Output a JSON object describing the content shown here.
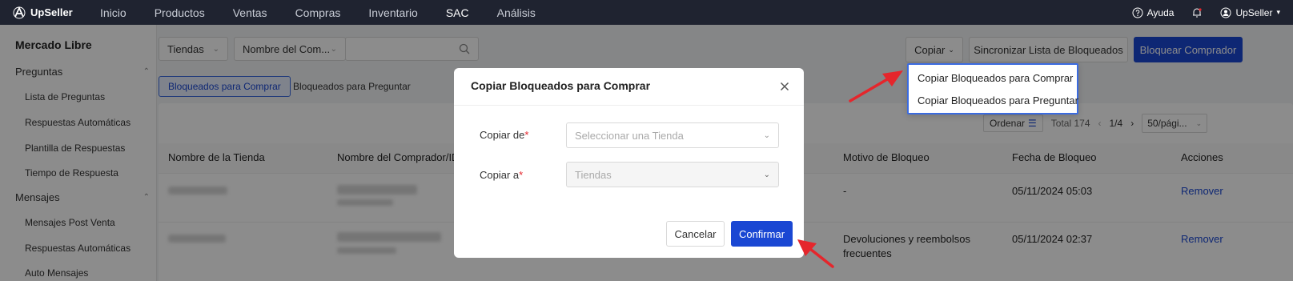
{
  "nav": {
    "brand": "UpSeller",
    "items": [
      "Inicio",
      "Productos",
      "Ventas",
      "Compras",
      "Inventario",
      "SAC",
      "Análisis"
    ],
    "active": "SAC",
    "help": "Ayuda",
    "user": "UpSeller"
  },
  "sidebar": {
    "title": "Mercado Libre",
    "sections": [
      {
        "label": "Preguntas",
        "items": [
          "Lista de Preguntas",
          "Respuestas Automáticas",
          "Plantilla de Respuestas",
          "Tiempo de Respuesta"
        ]
      },
      {
        "label": "Mensajes",
        "items": [
          "Mensajes Post Venta",
          "Respuestas Automáticas",
          "Auto Mensajes"
        ]
      }
    ]
  },
  "filters": {
    "store": "Tiendas",
    "buyer_field": "Nombre del Com...",
    "search_placeholder": ""
  },
  "actions": {
    "copy": "Copiar",
    "sync": "Sincronizar Lista de Bloqueados",
    "block": "Bloquear Comprador"
  },
  "tabs": {
    "active": "Bloqueados para Comprar",
    "other": "Bloqueados para Preguntar"
  },
  "table_toolbar": {
    "sort": "Ordenar",
    "total": "Total 174",
    "page": "1/4",
    "per_page": "50/pági..."
  },
  "table": {
    "columns": [
      "Nombre de la Tienda",
      "Nombre del Comprador/ID",
      "Motivo de Bloqueo",
      "Fecha de Bloqueo",
      "Acciones"
    ],
    "rows": [
      {
        "reason": "-",
        "reason_line2": "",
        "date": "05/11/2024 05:03",
        "action": "Remover"
      },
      {
        "reason": "Devoluciones y reembolsos",
        "reason_line2": "frecuentes",
        "date": "05/11/2024 02:37",
        "action": "Remover"
      }
    ]
  },
  "dropdown": {
    "items": [
      "Copiar Bloqueados para Comprar",
      "Copiar Bloqueados para Preguntar"
    ]
  },
  "modal": {
    "title": "Copiar Bloqueados para Comprar",
    "from_label": "Copiar de",
    "from_placeholder": "Seleccionar una Tienda",
    "to_label": "Copiar a",
    "to_value": "Tiendas",
    "required_mark": "*",
    "cancel": "Cancelar",
    "confirm": "Confirmar"
  },
  "colors": {
    "nav_bg": "#1f2330",
    "primary": "#1a47d3",
    "annotation_arrow": "#e5262c"
  }
}
